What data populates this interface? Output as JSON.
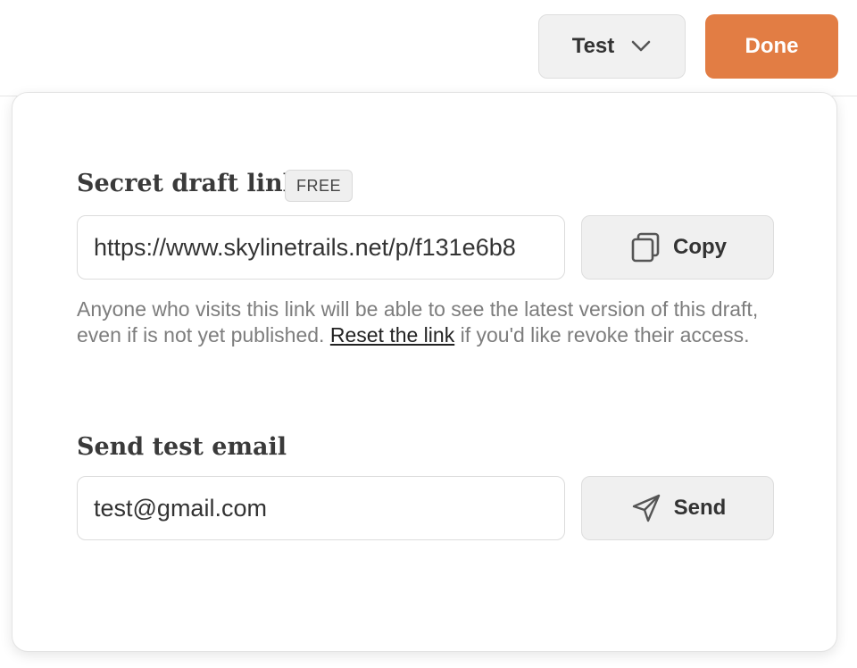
{
  "header": {
    "test_label": "Test",
    "done_label": "Done",
    "accent_color": "#e27d44"
  },
  "draft_link": {
    "title": "Secret draft link",
    "badge": "FREE",
    "url": "https://www.skylinetrails.net/p/f131e6b8",
    "copy_label": "Copy",
    "helper_before": "Anyone who visits this link will be able to see the latest version of this draft, even if is not yet published. ",
    "reset_link": "Reset the link",
    "helper_after": " if you'd like revoke their access."
  },
  "test_email": {
    "title": "Send test email",
    "email_value": "test@gmail.com",
    "send_label": "Send"
  },
  "icons": {
    "chevron": "chevron-down-icon",
    "copy": "copy-icon",
    "send": "paper-plane-icon"
  }
}
